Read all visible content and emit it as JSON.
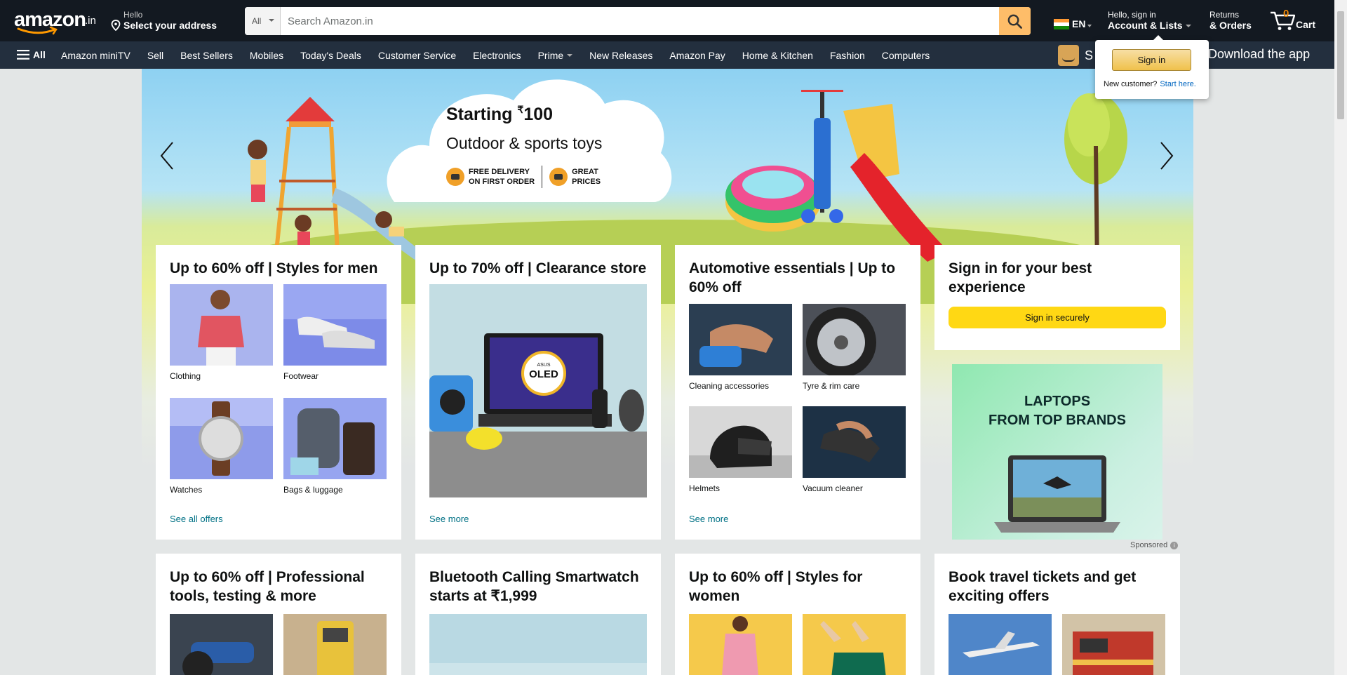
{
  "header": {
    "logo_text": "amazon",
    "logo_tld": ".in",
    "address": {
      "line1": "Hello",
      "line2": "Select your address"
    },
    "search": {
      "category": "All",
      "placeholder": "Search Amazon.in"
    },
    "language": "EN",
    "account": {
      "line1": "Hello, sign in",
      "line2": "Account & Lists"
    },
    "orders": {
      "line1": "Returns",
      "line2": "& Orders"
    },
    "cart": {
      "count": "0",
      "label": "Cart"
    }
  },
  "subnav": {
    "all_label": "All",
    "links": [
      "Amazon miniTV",
      "Sell",
      "Best Sellers",
      "Mobiles",
      "Today's Deals",
      "Customer Service",
      "Electronics",
      "Prime",
      "New Releases",
      "Amazon Pay",
      "Home & Kitchen",
      "Fashion",
      "Computers"
    ],
    "app_left": "S",
    "app_right": "Download the app"
  },
  "flyout": {
    "button": "Sign in",
    "new_customer": "New customer?",
    "start_here": "Start here."
  },
  "hero": {
    "title": "Starting",
    "title_rupee": "₹",
    "title_price": "100",
    "subtitle": "Outdoor & sports toys",
    "badge1_l1": "FREE DELIVERY",
    "badge1_l2": "ON FIRST ORDER",
    "badge2_l1": "GREAT",
    "badge2_l2": "PRICES"
  },
  "cards": {
    "men": {
      "title": "Up to 60% off | Styles for men",
      "items": [
        "Clothing",
        "Footwear",
        "Watches",
        "Bags & luggage"
      ],
      "link": "See all offers"
    },
    "clearance": {
      "title": "Up to 70% off | Clearance store",
      "screen_text": "OLED",
      "screen_brand": "ASUS",
      "link": "See more"
    },
    "auto": {
      "title": "Automotive essentials | Up to 60% off",
      "items": [
        "Cleaning accessories",
        "Tyre & rim care",
        "Helmets",
        "Vacuum cleaner"
      ],
      "link": "See more"
    },
    "signin": {
      "title": "Sign in for your best experience",
      "button": "Sign in securely"
    },
    "ad": {
      "line1": "LAPTOPS",
      "line2": "FROM TOP BRANDS",
      "sponsored": "Sponsored"
    },
    "tools": {
      "title": "Up to 60% off | Professional tools, testing & more"
    },
    "watch": {
      "title": "Bluetooth Calling Smartwatch starts at ₹1,999"
    },
    "women": {
      "title": "Up to 60% off | Styles for women"
    },
    "travel": {
      "title": "Book travel tickets and get exciting offers"
    }
  },
  "colors": {
    "nav_dark": "#131921",
    "nav_sub": "#232f3e",
    "search_button": "#febd69",
    "signin_yellow": "#ffd814",
    "link_teal": "#007185",
    "cart_count": "#f08804"
  }
}
